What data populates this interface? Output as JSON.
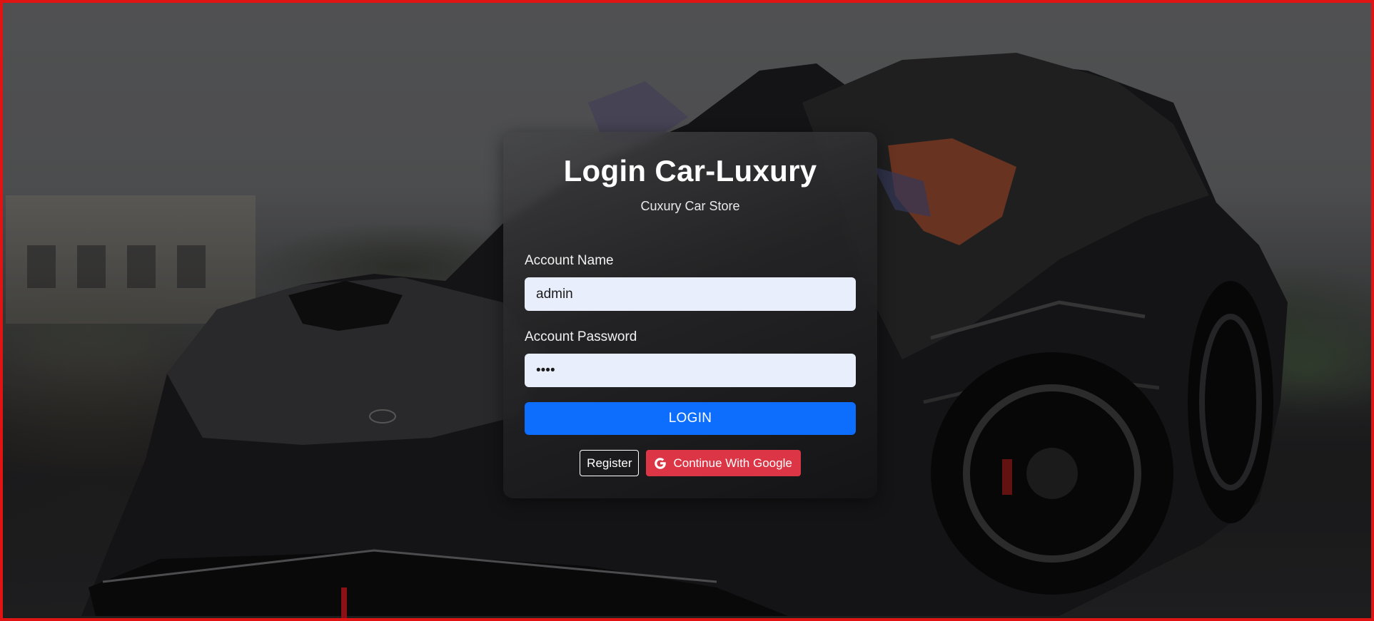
{
  "card": {
    "title": "Login Car-Luxury",
    "subtitle": "Cuxury Car Store"
  },
  "form": {
    "account_name_label": "Account Name",
    "account_name_value": "admin",
    "password_label": "Account Password",
    "password_value": "••••",
    "login_label": "LOGIN"
  },
  "actions": {
    "register_label": "Register",
    "google_label": "Continue With Google",
    "google_icon": "google-icon"
  },
  "colors": {
    "frame_border": "#e11414",
    "login_button": "#0d6efd",
    "google_button": "#dc3545",
    "input_background": "#e8eefb"
  }
}
